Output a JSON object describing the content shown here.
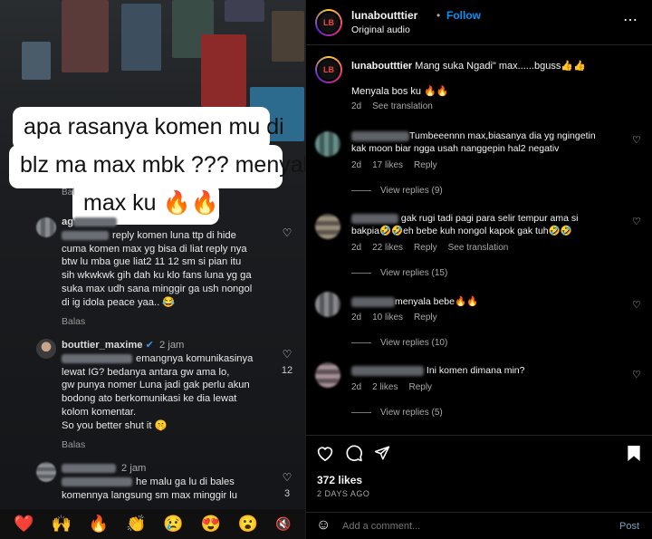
{
  "left_panel": {
    "overlay_lines": [
      "apa rasanya komen mu  di",
      "blz ma max mbk ??? menyala",
      "max ku 🔥🔥"
    ],
    "partial_behind": "Bal",
    "comment1": {
      "username_fragment": "ag",
      "text_lines": [
        "reply komen luna ttp di hide",
        "cuma komen max yg bisa di liat reply nya",
        "btw lu mba gue liat2 11 12 sm si pian itu",
        "sih wkwkwk gih dah ku klo fans luna yg ga",
        "suka max udh sana minggir ga ush nongol",
        "di ig idola  peace  yaa.. 😂"
      ],
      "reply": "Balas"
    },
    "comment2": {
      "username": "bouttier_maxime",
      "time": "2 jam",
      "likes": "12",
      "text_lines": [
        "emangnya komunikasinya",
        "lewat IG? bedanya antara gw ama lo,",
        "gw punya nomer Luna jadi gak perlu akun",
        "bodong ato berkomunikasi ke dia lewat",
        "kolom komentar.",
        "So you better shut it 🤫"
      ],
      "reply": "Balas"
    },
    "comment3": {
      "time": "2 jam",
      "likes": "3",
      "text_lines": [
        "he malu ga lu di bales",
        "komennya langsung sm max  minggir lu"
      ]
    },
    "emoji_bar": [
      "❤️",
      "🙌",
      "🔥",
      "👏",
      "😢",
      "😍",
      "😮"
    ]
  },
  "right_panel": {
    "header": {
      "username": "lunaboutttier",
      "dot": "•",
      "follow_label": "Follow",
      "subtitle": "Original audio",
      "more_icon": "more-horizontal-icon"
    },
    "caption": {
      "username": "lunaboutttier",
      "text": "Mang suka Ngadi\" max......bguss👍👍",
      "comment": "Menyala bos ku 🔥🔥",
      "time": "2d",
      "translation": "See translation"
    },
    "comments": [
      {
        "text_lines": [
          "Tumbeeennn max,biasanya dia yg ngingetin",
          "kak moon biar ngga usah nanggepin hal2 negativ"
        ],
        "time": "2d",
        "likes": "17 likes",
        "reply": "Reply",
        "view_replies": "View replies (9)"
      },
      {
        "text_lines": [
          "gak rugi tadi pagi para selir tempur ama si",
          "bakpia🤣🤣eh bebe kuh nongol kapok gak tuh🤣🤣"
        ],
        "time": "2d",
        "likes": "22 likes",
        "reply": "Reply",
        "translation": "See translation",
        "view_replies": "View replies (15)"
      },
      {
        "text_lines": [
          "menyala bebe🔥🔥"
        ],
        "time": "2d",
        "likes": "10 likes",
        "reply": "Reply",
        "view_replies": "View replies (10)"
      },
      {
        "text_lines": [
          "Ini komen dimana min?"
        ],
        "time": "2d",
        "likes": "2 likes",
        "reply": "Reply",
        "view_replies": "View replies (5)"
      }
    ],
    "likes": "372 likes",
    "posted": "2 DAYS AGO",
    "add_comment": {
      "placeholder": "Add a comment...",
      "post_label": "Post"
    }
  }
}
